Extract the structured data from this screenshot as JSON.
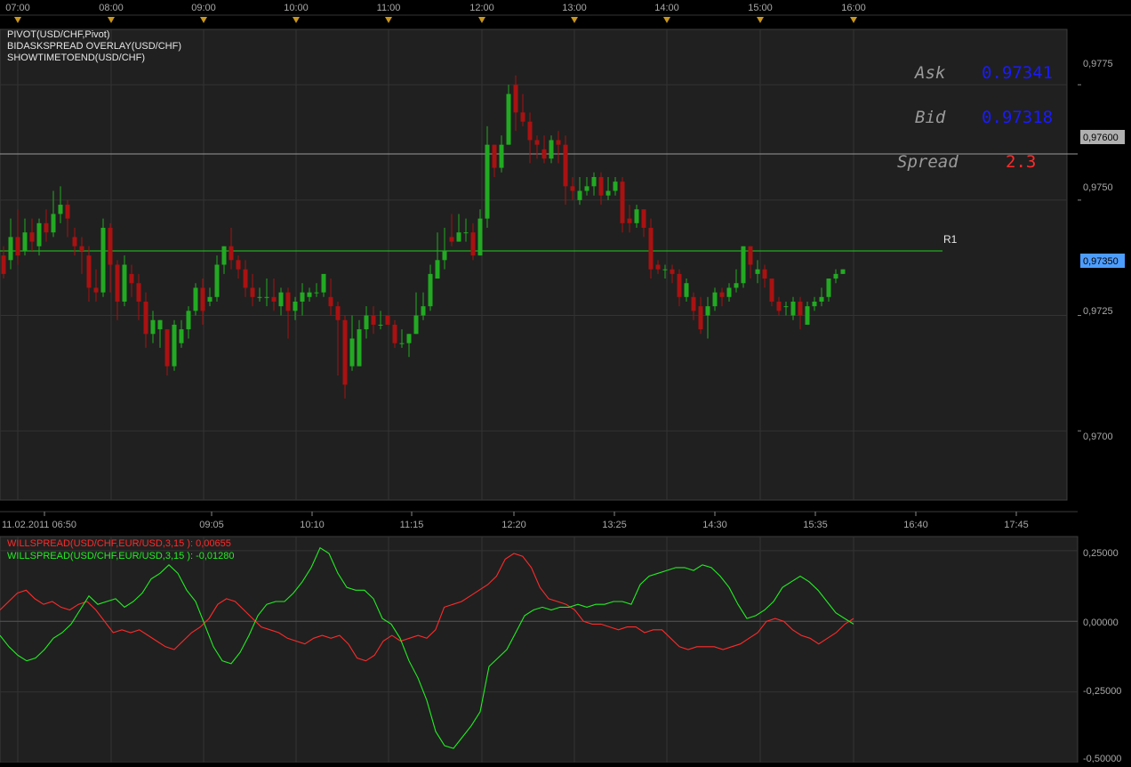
{
  "app": {
    "time_markers": [
      "07:00",
      "08:00",
      "09:00",
      "10:00",
      "11:00",
      "12:00",
      "13:00",
      "14:00",
      "15:00",
      "16:00"
    ],
    "bottom_axis_labels": [
      "11.02.2011 06:50",
      "09:05",
      "10:10",
      "11:15",
      "12:20",
      "13:25",
      "14:30",
      "15:35",
      "16:40",
      "17:45"
    ],
    "indicators": [
      "PIVOT(USD/CHF,Pivot)",
      "BIDASKSPREAD OVERLAY(USD/CHF)",
      "SHOWTIMETOEND(USD/CHF)"
    ],
    "price_axis_labels": [
      "0,9775",
      "0,9750",
      "0,9725",
      "0,9700"
    ],
    "price_highlight_label": "0,97600",
    "current_price_label": "0,97350",
    "pivot_label": "R1",
    "ask_label": "Ask",
    "ask_value": "0.97341",
    "bid_label": "Bid",
    "bid_value": "0.97318",
    "spread_label": "Spread",
    "spread_value": "2.3",
    "lower_legend_red": "WILLSPREAD(USD/CHF,EUR/USD,3,15 ): 0,00655",
    "lower_legend_green": "WILLSPREAD(USD/CHF,EUR/USD,3,15 ): -0,01280",
    "lower_axis_labels": [
      "0,25000",
      "0,00000",
      "-0,25000",
      "-0,50000"
    ]
  },
  "colors": {
    "background": "#000000",
    "panel": "#202020",
    "grid": "#333333",
    "axis_text": "#a8a8a8",
    "bull": "#22aa22",
    "bear": "#aa1111",
    "pivot_line": "#22cc22",
    "horizontal_line": "#9a9a9a",
    "ask_bid_value": "#1a1aff",
    "spread_value": "#ff2a2a",
    "label_text": "#aaaaaa",
    "marker": "#c8961e",
    "current_price_bg": "#4d9dff",
    "highlight_price_bg": "#b0b0b0",
    "osc_red": "#ff2a2a",
    "osc_green": "#22ee22"
  },
  "chart_data": [
    {
      "type": "candlestick",
      "title": "",
      "xlabel": "",
      "ylabel": "",
      "ylim": [
        0.9685,
        0.9787
      ],
      "grid": true,
      "reference_lines": [
        {
          "label": "",
          "y": 0.976
        },
        {
          "label": "R1",
          "y": 0.9739
        }
      ],
      "candles": [
        [
          0.9738,
          0.9734,
          0.9733,
          0.974
        ],
        [
          0.9737,
          0.9742,
          0.9735,
          0.9746
        ],
        [
          0.9742,
          0.9738,
          0.9736,
          0.9748
        ],
        [
          0.9739,
          0.9743,
          0.9738,
          0.9746
        ],
        [
          0.9743,
          0.9741,
          0.9739,
          0.9746
        ],
        [
          0.974,
          0.9745,
          0.9738,
          0.9746
        ],
        [
          0.9745,
          0.9743,
          0.9741,
          0.9748
        ],
        [
          0.9743,
          0.9747,
          0.9742,
          0.9752
        ],
        [
          0.9747,
          0.9749,
          0.9745,
          0.9753
        ],
        [
          0.9749,
          0.9746,
          0.9742,
          0.975
        ],
        [
          0.9742,
          0.974,
          0.9738,
          0.9744
        ],
        [
          0.974,
          0.9739,
          0.9734,
          0.9742
        ],
        [
          0.9738,
          0.9731,
          0.9728,
          0.974
        ],
        [
          0.9731,
          0.973,
          0.9728,
          0.9735
        ],
        [
          0.973,
          0.9744,
          0.9729,
          0.9746
        ],
        [
          0.9744,
          0.9736,
          0.973,
          0.9745
        ],
        [
          0.9736,
          0.9728,
          0.9724,
          0.9737
        ],
        [
          0.9728,
          0.9736,
          0.9727,
          0.9738
        ],
        [
          0.9734,
          0.9732,
          0.9729,
          0.9736
        ],
        [
          0.9732,
          0.9728,
          0.9724,
          0.9734
        ],
        [
          0.9728,
          0.9721,
          0.9718,
          0.973
        ],
        [
          0.9721,
          0.9724,
          0.9719,
          0.9726
        ],
        [
          0.9722,
          0.9724,
          0.9718,
          0.9724
        ],
        [
          0.9722,
          0.9714,
          0.9712,
          0.9722
        ],
        [
          0.9714,
          0.9723,
          0.9713,
          0.9724
        ],
        [
          0.9719,
          0.9722,
          0.9718,
          0.9724
        ],
        [
          0.9722,
          0.9726,
          0.972,
          0.9727
        ],
        [
          0.9726,
          0.9731,
          0.9725,
          0.9732
        ],
        [
          0.9731,
          0.9726,
          0.9723,
          0.9733
        ],
        [
          0.9728,
          0.9729,
          0.9727,
          0.9731
        ],
        [
          0.9729,
          0.9736,
          0.9728,
          0.9738
        ],
        [
          0.9736,
          0.974,
          0.9734,
          0.974
        ],
        [
          0.974,
          0.9737,
          0.9735,
          0.9744
        ],
        [
          0.9737,
          0.9735,
          0.9733,
          0.9738
        ],
        [
          0.9735,
          0.9731,
          0.9729,
          0.9737
        ],
        [
          0.9731,
          0.9729,
          0.9727,
          0.9734
        ],
        [
          0.9729,
          0.9729,
          0.9728,
          0.9731
        ],
        [
          0.9729,
          0.9729,
          0.9727,
          0.9733
        ],
        [
          0.9729,
          0.9728,
          0.9726,
          0.9733
        ],
        [
          0.9727,
          0.973,
          0.9725,
          0.9731
        ],
        [
          0.973,
          0.9726,
          0.972,
          0.9731
        ],
        [
          0.9726,
          0.9728,
          0.9724,
          0.9729
        ],
        [
          0.9728,
          0.973,
          0.9725,
          0.9732
        ],
        [
          0.9729,
          0.973,
          0.9728,
          0.9731
        ],
        [
          0.973,
          0.973,
          0.9729,
          0.9732
        ],
        [
          0.973,
          0.9734,
          0.9729,
          0.9733
        ],
        [
          0.9729,
          0.9727,
          0.9725,
          0.9733
        ],
        [
          0.9727,
          0.9724,
          0.9712,
          0.9728
        ],
        [
          0.9724,
          0.971,
          0.9707,
          0.9725
        ],
        [
          0.9714,
          0.972,
          0.9713,
          0.9725
        ],
        [
          0.9714,
          0.9722,
          0.9714,
          0.9724
        ],
        [
          0.9722,
          0.9725,
          0.972,
          0.9727
        ],
        [
          0.9725,
          0.9723,
          0.9721,
          0.9727
        ],
        [
          0.9723,
          0.9723,
          0.9722,
          0.9726
        ],
        [
          0.9725,
          0.9723,
          0.9723,
          0.9725
        ],
        [
          0.9723,
          0.9719,
          0.9718,
          0.9724
        ],
        [
          0.9719,
          0.9719,
          0.9718,
          0.9722
        ],
        [
          0.9719,
          0.9721,
          0.9716,
          0.9721
        ],
        [
          0.9721,
          0.9725,
          0.9721,
          0.973
        ],
        [
          0.9725,
          0.9727,
          0.9724,
          0.973
        ],
        [
          0.9727,
          0.9734,
          0.9726,
          0.9736
        ],
        [
          0.9733,
          0.9737,
          0.9733,
          0.9743
        ],
        [
          0.9737,
          0.9739,
          0.9735,
          0.9744
        ],
        [
          0.9742,
          0.9741,
          0.974,
          0.9747
        ],
        [
          0.9741,
          0.9743,
          0.9741,
          0.9747
        ],
        [
          0.9743,
          0.9743,
          0.9741,
          0.9746
        ],
        [
          0.9743,
          0.9738,
          0.9737,
          0.9745
        ],
        [
          0.9738,
          0.9746,
          0.9738,
          0.9748
        ],
        [
          0.9746,
          0.9762,
          0.9744,
          0.9766
        ],
        [
          0.9762,
          0.9757,
          0.9755,
          0.9762
        ],
        [
          0.9757,
          0.9762,
          0.9756,
          0.9764
        ],
        [
          0.9762,
          0.9773,
          0.9762,
          0.9775
        ],
        [
          0.9775,
          0.9769,
          0.9765,
          0.9777
        ],
        [
          0.9769,
          0.9767,
          0.9766,
          0.9773
        ],
        [
          0.9767,
          0.9763,
          0.9758,
          0.9769
        ],
        [
          0.9763,
          0.9762,
          0.9759,
          0.9764
        ],
        [
          0.9761,
          0.9759,
          0.9758,
          0.9764
        ],
        [
          0.9759,
          0.9763,
          0.9758,
          0.9764
        ],
        [
          0.9763,
          0.9762,
          0.9758,
          0.9765
        ],
        [
          0.9762,
          0.9753,
          0.9749,
          0.9764
        ],
        [
          0.9753,
          0.9752,
          0.975,
          0.9755
        ],
        [
          0.975,
          0.9752,
          0.9749,
          0.9755
        ],
        [
          0.9752,
          0.9753,
          0.9751,
          0.9755
        ],
        [
          0.9753,
          0.9755,
          0.9751,
          0.9756
        ],
        [
          0.9755,
          0.9751,
          0.9749,
          0.9756
        ],
        [
          0.9751,
          0.9752,
          0.975,
          0.9755
        ],
        [
          0.9752,
          0.9754,
          0.9751,
          0.9755
        ],
        [
          0.9754,
          0.9745,
          0.9743,
          0.9755
        ],
        [
          0.9746,
          0.9745,
          0.9743,
          0.9749
        ],
        [
          0.9745,
          0.9748,
          0.9744,
          0.9749
        ],
        [
          0.9748,
          0.9744,
          0.9742,
          0.9748
        ],
        [
          0.9744,
          0.9735,
          0.9733,
          0.9746
        ],
        [
          0.9736,
          0.9735,
          0.9734,
          0.9737
        ],
        [
          0.9735,
          0.9735,
          0.9733,
          0.9736
        ],
        [
          0.9735,
          0.9734,
          0.9732,
          0.9736
        ],
        [
          0.9734,
          0.9729,
          0.9727,
          0.9735
        ],
        [
          0.9729,
          0.9732,
          0.9728,
          0.9733
        ],
        [
          0.9729,
          0.9726,
          0.9724,
          0.973
        ],
        [
          0.9727,
          0.9722,
          0.9721,
          0.9729
        ],
        [
          0.9725,
          0.9727,
          0.972,
          0.9729
        ],
        [
          0.9727,
          0.973,
          0.9726,
          0.9731
        ],
        [
          0.973,
          0.9729,
          0.9727,
          0.9731
        ],
        [
          0.9729,
          0.9731,
          0.9728,
          0.9732
        ],
        [
          0.9731,
          0.9732,
          0.973,
          0.9735
        ],
        [
          0.9732,
          0.974,
          0.9731,
          0.974
        ],
        [
          0.974,
          0.9736,
          0.9733,
          0.974
        ],
        [
          0.9734,
          0.9735,
          0.9732,
          0.9737
        ],
        [
          0.9735,
          0.9733,
          0.9731,
          0.9736
        ],
        [
          0.9733,
          0.9728,
          0.9727,
          0.9733
        ],
        [
          0.9728,
          0.9726,
          0.9725,
          0.9729
        ],
        [
          0.9727,
          0.9727,
          0.9725,
          0.9728
        ],
        [
          0.9725,
          0.9728,
          0.9724,
          0.9729
        ],
        [
          0.9728,
          0.9725,
          0.9722,
          0.9729
        ],
        [
          0.9723,
          0.9727,
          0.9723,
          0.9728
        ],
        [
          0.9727,
          0.9728,
          0.9726,
          0.9729
        ],
        [
          0.9728,
          0.9729,
          0.9727,
          0.9731
        ],
        [
          0.9729,
          0.9733,
          0.9728,
          0.9733
        ],
        [
          0.9733,
          0.9734,
          0.9732,
          0.9735
        ],
        [
          0.9734,
          0.9735,
          0.9734,
          0.9735
        ]
      ],
      "x_tick_labels": [
        "11.02.2011 06:50",
        "09:05",
        "10:10",
        "11:15",
        "12:20",
        "13:25",
        "14:30",
        "15:35",
        "16:40",
        "17:45"
      ],
      "y_tick_labels": [
        "0,9775",
        "0,9750",
        "0,9725",
        "0,9700"
      ]
    },
    {
      "type": "line",
      "title": "",
      "xlabel": "",
      "ylabel": "",
      "ylim": [
        -0.5,
        0.3
      ],
      "grid": true,
      "series": [
        {
          "name": "WILLSPREAD(USD/CHF,EUR/USD,3,15 ): 0,00655",
          "color": "#ff2a2a",
          "values": [
            0.04,
            0.07,
            0.1,
            0.11,
            0.08,
            0.06,
            0.07,
            0.05,
            0.04,
            0.06,
            0.07,
            0.04,
            0.0,
            -0.04,
            -0.03,
            -0.04,
            -0.03,
            -0.05,
            -0.07,
            -0.09,
            -0.1,
            -0.07,
            -0.04,
            -0.02,
            0.01,
            0.06,
            0.08,
            0.07,
            0.04,
            0.01,
            -0.02,
            -0.03,
            -0.04,
            -0.06,
            -0.07,
            -0.08,
            -0.06,
            -0.05,
            -0.06,
            -0.05,
            -0.08,
            -0.13,
            -0.14,
            -0.12,
            -0.07,
            -0.05,
            -0.07,
            -0.06,
            -0.05,
            -0.06,
            -0.03,
            0.05,
            0.06,
            0.07,
            0.09,
            0.11,
            0.13,
            0.16,
            0.22,
            0.24,
            0.23,
            0.19,
            0.12,
            0.08,
            0.07,
            0.06,
            0.04,
            0.0,
            -0.01,
            -0.01,
            -0.02,
            -0.03,
            -0.02,
            -0.02,
            -0.04,
            -0.03,
            -0.03,
            -0.06,
            -0.09,
            -0.1,
            -0.09,
            -0.09,
            -0.09,
            -0.1,
            -0.09,
            -0.08,
            -0.06,
            -0.04,
            0.0,
            0.01,
            0.0,
            -0.03,
            -0.05,
            -0.06,
            -0.08,
            -0.06,
            -0.04,
            -0.01,
            0.01
          ]
        },
        {
          "name": "WILLSPREAD(USD/CHF,EUR/USD,3,15 ): -0,01280",
          "color": "#22ee22",
          "values": [
            -0.05,
            -0.09,
            -0.12,
            -0.14,
            -0.13,
            -0.1,
            -0.06,
            -0.04,
            -0.01,
            0.04,
            0.09,
            0.06,
            0.07,
            0.08,
            0.05,
            0.07,
            0.1,
            0.15,
            0.17,
            0.2,
            0.17,
            0.11,
            0.07,
            -0.01,
            -0.09,
            -0.14,
            -0.15,
            -0.11,
            -0.05,
            0.02,
            0.06,
            0.07,
            0.07,
            0.1,
            0.14,
            0.19,
            0.26,
            0.24,
            0.17,
            0.12,
            0.11,
            0.11,
            0.08,
            0.01,
            -0.01,
            -0.06,
            -0.14,
            -0.2,
            -0.28,
            -0.39,
            -0.44,
            -0.45,
            -0.41,
            -0.37,
            -0.32,
            -0.16,
            -0.13,
            -0.1,
            -0.04,
            0.02,
            0.04,
            0.05,
            0.04,
            0.05,
            0.05,
            0.06,
            0.05,
            0.06,
            0.06,
            0.07,
            0.07,
            0.06,
            0.13,
            0.16,
            0.17,
            0.18,
            0.19,
            0.19,
            0.18,
            0.2,
            0.19,
            0.16,
            0.12,
            0.06,
            0.01,
            0.02,
            0.04,
            0.07,
            0.12,
            0.14,
            0.16,
            0.14,
            0.11,
            0.07,
            0.03,
            0.01,
            -0.01
          ]
        }
      ],
      "reference_lines": [
        {
          "label": "",
          "y": 0
        }
      ],
      "y_tick_labels": [
        "0,25000",
        "0,00000",
        "-0,25000",
        "-0,50000"
      ]
    }
  ]
}
